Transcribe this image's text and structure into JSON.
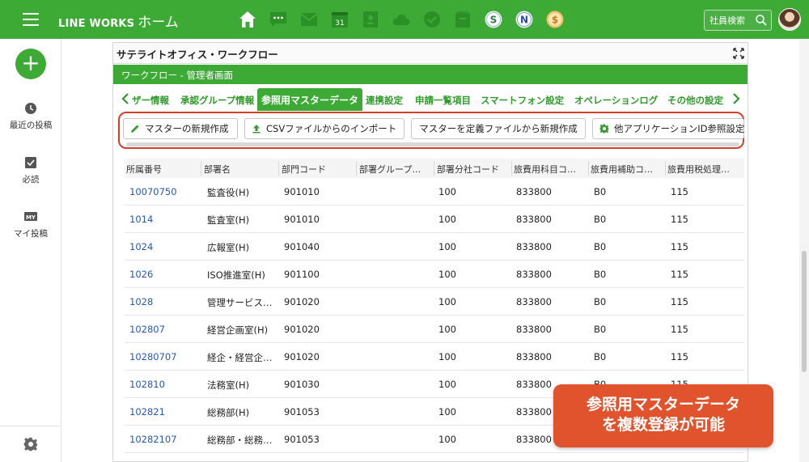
{
  "topbar": {
    "brand": "LINE WORKS",
    "brand_suffix": "ホーム",
    "apps": [
      {
        "icon": "home-icon"
      },
      {
        "icon": "talk-icon"
      },
      {
        "icon": "mail-icon"
      },
      {
        "icon": "calendar-icon",
        "label": "31"
      },
      {
        "icon": "contacts-icon"
      },
      {
        "icon": "drive-icon"
      },
      {
        "icon": "task-icon"
      },
      {
        "icon": "archive-icon"
      },
      {
        "icon": "app-s-icon",
        "label": "S"
      },
      {
        "icon": "app-n-icon",
        "label": "N"
      },
      {
        "icon": "app-dollar-icon",
        "label": "$"
      }
    ],
    "search_label": "社員検索"
  },
  "sidebar": {
    "items": [
      {
        "label": "最近の投稿",
        "icon": "clock-icon"
      },
      {
        "label": "必読",
        "icon": "check-icon"
      },
      {
        "label": "マイ投稿",
        "icon": "my-icon",
        "badge": "MY"
      }
    ]
  },
  "panel": {
    "title": "サテライトオフィス・ワークフロー",
    "subtitle": "ワークフロー - 管理者画面",
    "tabs": [
      {
        "label": "ザー情報",
        "active": false
      },
      {
        "label": "承認グループ情報",
        "active": false
      },
      {
        "label": "参照用マスターデータ",
        "active": true
      },
      {
        "label": "連携設定",
        "active": false
      },
      {
        "label": "申請一覧項目",
        "active": false
      },
      {
        "label": "スマートフォン設定",
        "active": false
      },
      {
        "label": "オペレーションログ",
        "active": false
      },
      {
        "label": "その他の設定",
        "active": false
      }
    ],
    "buttons": [
      {
        "label": "マスターの新規作成",
        "icon": "pencil-icon"
      },
      {
        "label": "CSVファイルからのインポート",
        "icon": "upload-icon"
      },
      {
        "label": "マスターを定義ファイルから新規作成",
        "icon": ""
      },
      {
        "label": "他アプリケーションID参照設定",
        "icon": "gear-icon"
      }
    ]
  },
  "table": {
    "headers": [
      "所属番号",
      "部署名",
      "部門コード",
      "部署グループ…",
      "部署分社コード",
      "旅費用科目コ…",
      "旅費用補助コ…",
      "旅費用税処理…"
    ],
    "rows": [
      [
        "10070750",
        "監査役(H)",
        "901010",
        "",
        "100",
        "833800",
        "B0",
        "115"
      ],
      [
        "1014",
        "監査室(H)",
        "901010",
        "",
        "100",
        "833800",
        "B0",
        "115"
      ],
      [
        "1024",
        "広報室(H)",
        "901040",
        "",
        "100",
        "833800",
        "B0",
        "115"
      ],
      [
        "1026",
        "ISO推進室(H)",
        "901100",
        "",
        "100",
        "833800",
        "B0",
        "115"
      ],
      [
        "1028",
        "管理サービス…",
        "901020",
        "",
        "100",
        "833800",
        "B0",
        "115"
      ],
      [
        "102807",
        "経営企画室(H)",
        "901020",
        "",
        "100",
        "833800",
        "B0",
        "115"
      ],
      [
        "10280707",
        "経企・経営企…",
        "901020",
        "",
        "100",
        "833800",
        "B0",
        "115"
      ],
      [
        "102810",
        "法務室(H)",
        "901030",
        "",
        "100",
        "833800",
        "B0",
        "115"
      ],
      [
        "102821",
        "総務部(H)",
        "901053",
        "",
        "100",
        "833800",
        "",
        ""
      ],
      [
        "10282107",
        "総務部・総務…",
        "901053",
        "",
        "100",
        "833800",
        "",
        ""
      ]
    ]
  },
  "callout": {
    "line1": "参照用マスターデータ",
    "line2": "を複数登録が可能"
  },
  "colors": {
    "brand_green": "#3caa35",
    "link_blue": "#2458b8",
    "highlight_red": "#d2402a",
    "callout_orange": "#e0532c"
  }
}
